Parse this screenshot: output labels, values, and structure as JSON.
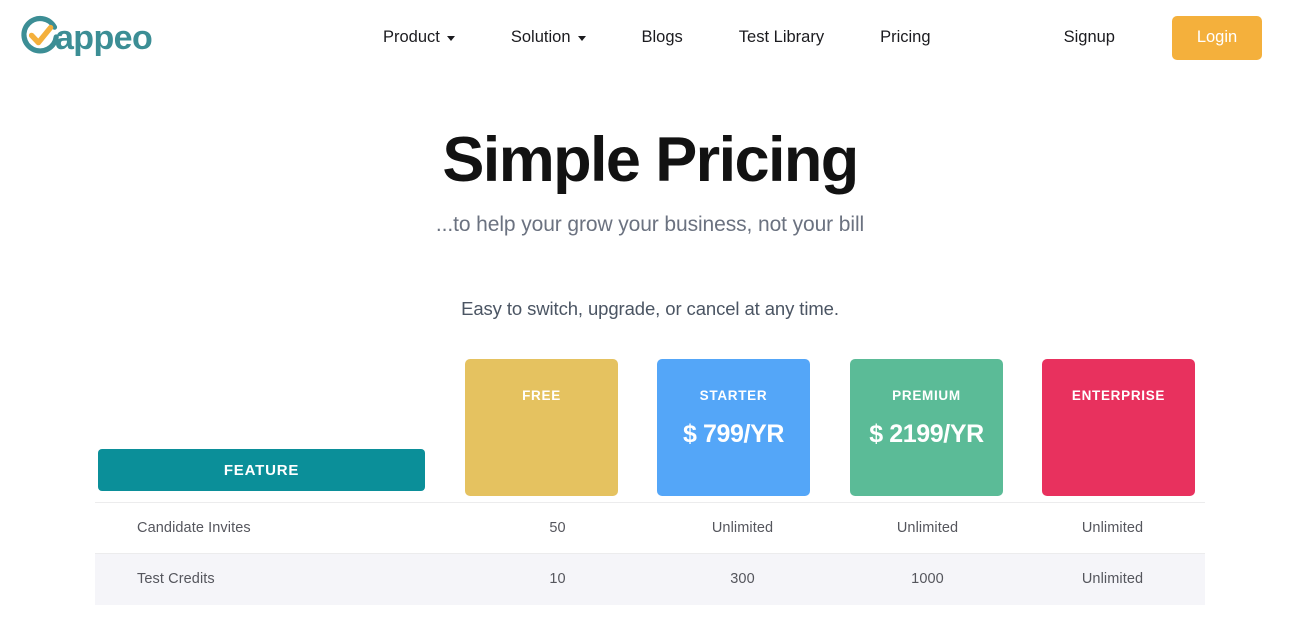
{
  "brand": {
    "name": "appeo",
    "full_name": "Gappeo",
    "logo_icon": "gappeo-check-circle-icon",
    "mark_color": "#3c8e95",
    "check_color": "#f4b03c"
  },
  "nav": {
    "items": [
      {
        "label": "Product",
        "has_dropdown": true,
        "icon": "chevron-down-icon"
      },
      {
        "label": "Solution",
        "has_dropdown": true,
        "icon": "chevron-down-icon"
      },
      {
        "label": "Blogs",
        "has_dropdown": false
      },
      {
        "label": "Test Library",
        "has_dropdown": false
      },
      {
        "label": "Pricing",
        "has_dropdown": false
      }
    ],
    "signup_label": "Signup",
    "login_label": "Login",
    "login_bg": "#f4b03c"
  },
  "hero": {
    "title": "Simple Pricing",
    "subtitle": "...to help your grow your business, not your bill",
    "note": "Easy to switch, upgrade, or cancel at any time."
  },
  "pricing": {
    "feature_header": "FEATURE",
    "feature_header_bg": "#0b8f99",
    "plans": [
      {
        "name": "FREE",
        "price": "",
        "color": "#e5c260"
      },
      {
        "name": "STARTER",
        "price": "$ 799/YR",
        "color": "#54a6f8"
      },
      {
        "name": "PREMIUM",
        "price": "$ 2199/YR",
        "color": "#5bbb97"
      },
      {
        "name": "ENTERPRISE",
        "price": "",
        "color": "#e8315e"
      }
    ],
    "rows": [
      {
        "feature": "Candidate Invites",
        "values": [
          "50",
          "Unlimited",
          "Unlimited",
          "Unlimited"
        ],
        "striped": false
      },
      {
        "feature": "Test Credits",
        "values": [
          "10",
          "300",
          "1000",
          "Unlimited"
        ],
        "striped": true
      }
    ]
  }
}
